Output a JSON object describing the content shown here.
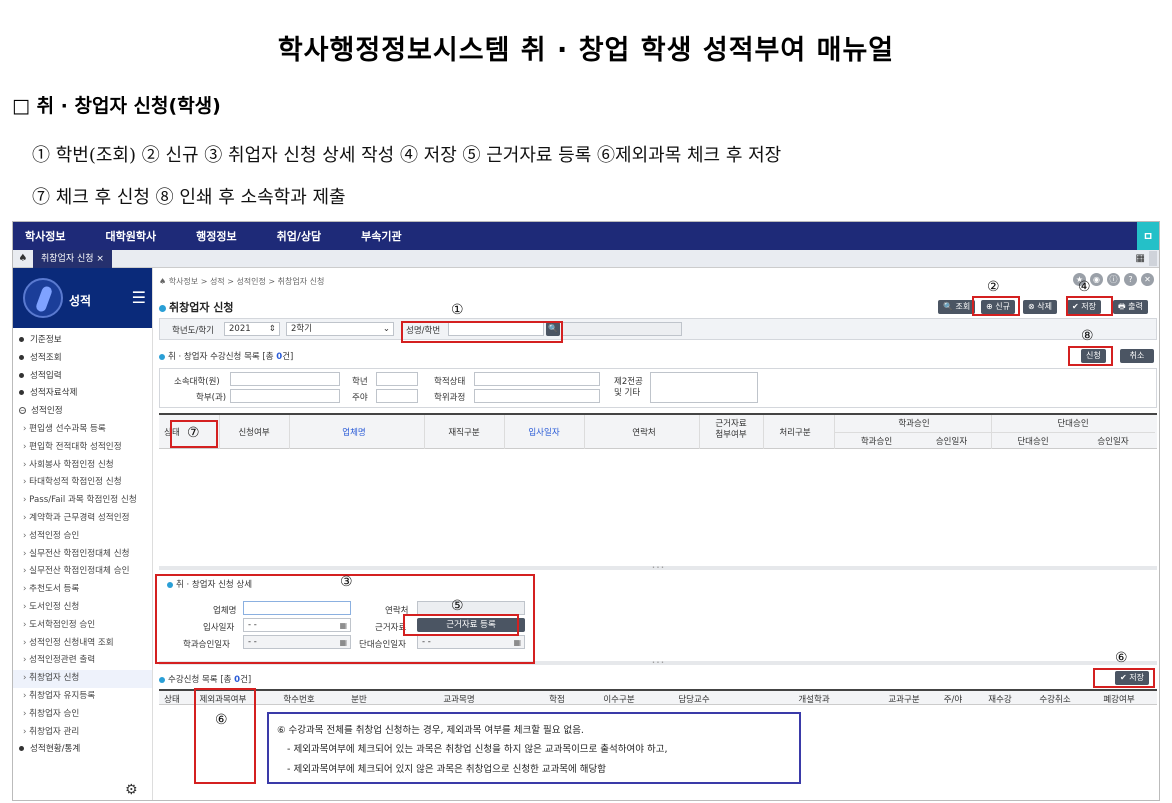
{
  "doc": {
    "title": "학사행정정보시스템 취 · 창업 학생 성적부여 매뉴얼",
    "section": "□ 취 · 창업자 신청(학생)",
    "steps_line1": "① 학번(조회) ② 신규 ③ 취업자 신청 상세 작성 ④ 저장 ⑤ 근거자료 등록 ⑥제외과목 체크 후 저장",
    "steps_line2": "⑦ 체크 후 신청 ⑧ 인쇄 후 소속학과 제출"
  },
  "nav": {
    "items": [
      "학사정보",
      "대학원학사",
      "행정정보",
      "취업/상담",
      "부속기관"
    ],
    "bookmark": "ㅁ"
  },
  "tabs": {
    "home": "♠",
    "active": "취창업자 신청 ×",
    "grid": "▦"
  },
  "sidebar": {
    "title": "성적",
    "menu_icon": "☰",
    "gear": "⚙",
    "items": [
      {
        "label": "기준정보",
        "kind": "top"
      },
      {
        "label": "성적조회",
        "kind": "top"
      },
      {
        "label": "성적입력",
        "kind": "top"
      },
      {
        "label": "성적자료삭제",
        "kind": "top"
      },
      {
        "label": "성적인정",
        "kind": "open"
      },
      {
        "label": "편입생 선수과목 등록",
        "kind": "sub"
      },
      {
        "label": "편입학 전적대학 성적인정",
        "kind": "sub"
      },
      {
        "label": "사회봉사 학점인정 신청",
        "kind": "sub"
      },
      {
        "label": "타대학성적 학점인정 신청",
        "kind": "sub"
      },
      {
        "label": "Pass/Fail 과목 학점인정 신청",
        "kind": "sub"
      },
      {
        "label": "계약학과 근무경력 성적인정",
        "kind": "sub"
      },
      {
        "label": "성적인정 승인",
        "kind": "sub"
      },
      {
        "label": "실무전산 학점인정대체 신청",
        "kind": "sub"
      },
      {
        "label": "실무전산 학점인정대체 승인",
        "kind": "sub"
      },
      {
        "label": "추천도서 등록",
        "kind": "sub"
      },
      {
        "label": "도서인정 신청",
        "kind": "sub"
      },
      {
        "label": "도서학점인정 승인",
        "kind": "sub"
      },
      {
        "label": "성적인정 신청내역 조회",
        "kind": "sub"
      },
      {
        "label": "성적인정관련 출력",
        "kind": "sub"
      },
      {
        "label": "취창업자 신청",
        "kind": "sub-active"
      },
      {
        "label": "취창업자 유지등록",
        "kind": "sub"
      },
      {
        "label": "취창업자 승인",
        "kind": "sub"
      },
      {
        "label": "취창업자 관리",
        "kind": "sub"
      },
      {
        "label": "성적현황/통계",
        "kind": "top"
      }
    ]
  },
  "main": {
    "breadcrumb": "♠ 학사정보 > 성적 > 성적인정 > 취창업자 신청",
    "header_icons": [
      "★",
      "◉",
      "ⓘ",
      "?",
      "✕"
    ],
    "page_title": "취창업자 신청",
    "buttons": {
      "search": "🔍 조회",
      "new": "⊕ 신규",
      "delete": "⊗ 삭제",
      "save": "✔ 저장",
      "print": "🖶 출력",
      "apply": "신청",
      "cancel": "취소",
      "save2": "✔ 저장"
    },
    "filter": {
      "year_term_label": "학년도/학기",
      "year": "2021",
      "term": "2학기",
      "name_label": "성명/학번",
      "name_value": "",
      "search_icon": "🔍"
    },
    "list_title": "취 · 창업자 수강신청 목록",
    "list_count_prefix": "[총 ",
    "list_count": "0",
    "list_count_suffix": "건]",
    "search_labels": {
      "college": "소속대학(원)",
      "dept": "학부(과)",
      "grade": "학년",
      "daynight": "주야",
      "status": "학적상태",
      "program": "학위과정",
      "second_major": "제2전공\n및 기타"
    },
    "table_headers": {
      "status": "상태",
      "apply": "신청여부",
      "company": "업체명",
      "job_type": "재직구분",
      "join_date": "입사일자",
      "contact": "연락처",
      "evidence": "근거자료\n첨부여부",
      "process": "처리구분",
      "dept_approval": "학과승인",
      "dept_ok": "학과승인",
      "dept_date": "승인일자",
      "group_approval": "단대승인",
      "group_ok": "단대승인",
      "group_date": "승인일자"
    },
    "detail": {
      "title": "취 · 창업자 신청 상세",
      "company_label": "업체명",
      "join_label": "입사일자",
      "join_value": "-   -",
      "dept_date_label": "학과승인일자",
      "dept_date_value": "-   -",
      "contact_label": "연락처",
      "evidence_label": "근거자료",
      "evidence_button": "근거자료 등록",
      "group_date_label": "단대승인일자",
      "group_date_value": "-   -",
      "cal_icon": "▦"
    },
    "course_title": "수강신청 목록",
    "course_count_prefix": "[총 ",
    "course_count": "0",
    "course_count_suffix": "건]",
    "course_headers": [
      "상태",
      "제외과목여부",
      "학수번호",
      "분반",
      "교과목명",
      "학점",
      "이수구분",
      "담당교수",
      "개설학과",
      "교과구분",
      "주/야",
      "재수강",
      "수강취소",
      "폐강여부"
    ],
    "notes": [
      "⑥ 수강과목 전체를 취창업 신청하는 경우, 제외과목 여부를 체크할 필요 없음.",
      "- 제외과목여부에 체크되어 있는 과목은 취창업 신청을 하지 않은 교과목이므로 출석하여야 하고,",
      "- 제외과목여부에 체크되어 있지 않은 과목은 취창업으로 신청한 교과목에 해당함"
    ]
  },
  "markers": {
    "m1": "①",
    "m2": "②",
    "m3": "③",
    "m4": "④",
    "m5": "⑤",
    "m6a": "⑥",
    "m6b": "⑥",
    "m7": "⑦",
    "m8": "⑧"
  }
}
